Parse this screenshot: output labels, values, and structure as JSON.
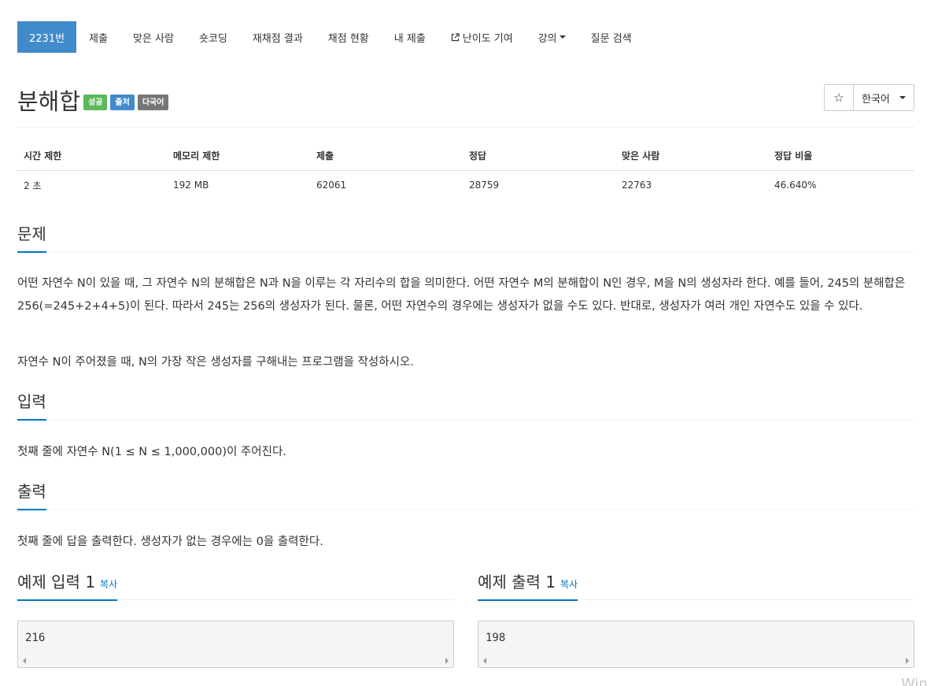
{
  "nav": {
    "items": [
      {
        "label": "2231번",
        "active": true
      },
      {
        "label": "제출"
      },
      {
        "label": "맞은 사람"
      },
      {
        "label": "숏코딩"
      },
      {
        "label": "재채점 결과"
      },
      {
        "label": "채점 현황"
      },
      {
        "label": "내 제출"
      },
      {
        "label": "난이도 기여",
        "icon": "external-link-icon"
      },
      {
        "label": "강의",
        "icon": "caret-down-icon"
      },
      {
        "label": "질문 검색"
      }
    ]
  },
  "problem": {
    "title": "분해합",
    "labels": [
      {
        "text": "성공",
        "color": "#5cb85c"
      },
      {
        "text": "출처",
        "color": "#428bca"
      },
      {
        "text": "다국어",
        "color": "#777777"
      }
    ],
    "star_icon": "☆",
    "language": "한국어"
  },
  "info": {
    "headers": [
      "시간 제한",
      "메모리 제한",
      "제출",
      "정답",
      "맞은 사람",
      "정답 비율"
    ],
    "values": [
      "2 초",
      "192 MB",
      "62061",
      "28759",
      "22763",
      "46.640%"
    ]
  },
  "sections": {
    "description": {
      "title": "문제",
      "paragraphs": [
        "어떤 자연수 N이 있을 때, 그 자연수 N의 분해합은 N과 N을 이루는 각 자리수의 합을 의미한다. 어떤 자연수 M의 분해합이 N인 경우, M을 N의 생성자라 한다. 예를 들어, 245의 분해합은 256(=245+2+4+5)이 된다. 따라서 245는 256의 생성자가 된다. 물론, 어떤 자연수의 경우에는 생성자가 없을 수도 있다. 반대로, 생성자가 여러 개인 자연수도 있을 수 있다.",
        "자연수 N이 주어졌을 때, N의 가장 작은 생성자를 구해내는 프로그램을 작성하시오."
      ]
    },
    "input": {
      "title": "입력",
      "text": "첫째 줄에 자연수 N(1 ≤ N ≤ 1,000,000)이 주어진다."
    },
    "output": {
      "title": "출력",
      "text": "첫째 줄에 답을 출력한다. 생성자가 없는 경우에는 0을 출력한다."
    }
  },
  "samples": {
    "input": {
      "title": "예제 입력 1",
      "copy": "복사",
      "value": "216"
    },
    "output": {
      "title": "예제 출력 1",
      "copy": "복사",
      "value": "198"
    }
  },
  "watermark": "Win",
  "colors": {
    "accent": "#428bca",
    "link": "#0076c0"
  }
}
